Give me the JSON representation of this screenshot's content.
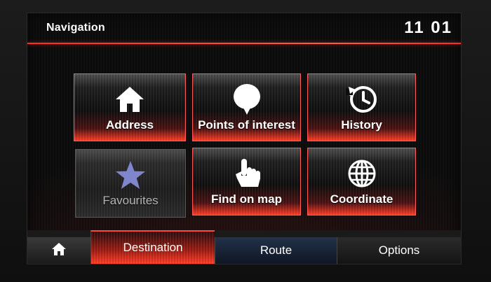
{
  "header": {
    "title": "Navigation",
    "clock": "11 01"
  },
  "tiles": [
    {
      "label": "Address",
      "icon": "house-icon",
      "enabled": true
    },
    {
      "label": "Points of interest",
      "icon": "poi-pin-icon",
      "enabled": true
    },
    {
      "label": "History",
      "icon": "history-clock-icon",
      "enabled": true
    },
    {
      "label": "Favourites",
      "icon": "star-icon",
      "enabled": false
    },
    {
      "label": "Find on map",
      "icon": "pointing-hand-icon",
      "enabled": true
    },
    {
      "label": "Coordinate",
      "icon": "globe-icon",
      "enabled": true
    }
  ],
  "tabs": [
    {
      "label": "",
      "icon": "home-icon"
    },
    {
      "label": "Destination",
      "active": true
    },
    {
      "label": "Route"
    },
    {
      "label": "Options"
    }
  ],
  "colors": {
    "accent": "#ff3b24",
    "disabled_star": "#7f86cc"
  }
}
